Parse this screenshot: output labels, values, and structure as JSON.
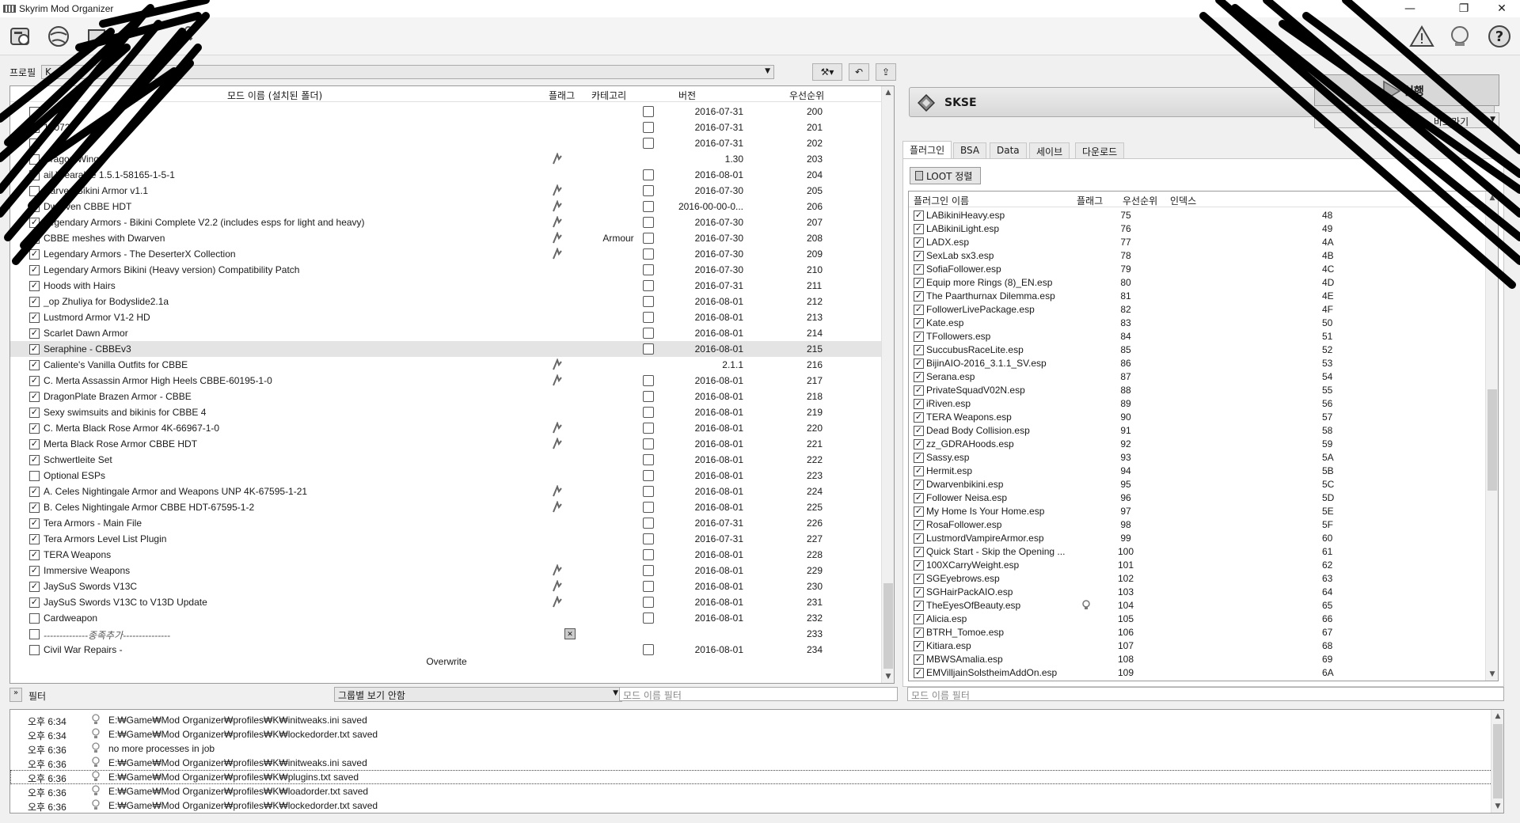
{
  "window": {
    "title": "Skyrim Mod Organizer",
    "minimize": "—",
    "maximize": "❐",
    "close": "✕"
  },
  "profile": {
    "label": "프로필",
    "value": "K"
  },
  "modlist": {
    "headers": {
      "name": "모드 이름 (설치된 폴더)",
      "flags": "플래그",
      "category": "카테고리",
      "version": "버전",
      "priority": "우선순위"
    },
    "rows": [
      {
        "name": "",
        "checked": "",
        "flag": false,
        "category": "",
        "verico": true,
        "version": "2016-07-31",
        "priority": "200"
      },
      {
        "name": "160721",
        "checked": "",
        "flag": false,
        "category": "",
        "verico": true,
        "version": "2016-07-31",
        "priority": "201"
      },
      {
        "name": "",
        "checked": "",
        "flag": false,
        "category": "",
        "verico": true,
        "version": "2016-07-31",
        "priority": "202"
      },
      {
        "name": "Dragon Wings",
        "checked": "",
        "flag": true,
        "category": "",
        "verico": false,
        "version": "1.30",
        "priority": "203"
      },
      {
        "name": "ail Wearable 1.5.1-58165-1-5-1",
        "checked": "",
        "flag": false,
        "category": "",
        "verico": true,
        "version": "2016-08-01",
        "priority": "204"
      },
      {
        "name": "warven Bikini Armor v1.1",
        "checked": "",
        "flag": true,
        "category": "",
        "verico": true,
        "version": "2016-07-30",
        "priority": "205"
      },
      {
        "name": "Dwarven CBBE HDT",
        "checked": "",
        "flag": true,
        "category": "",
        "verico": true,
        "version": "2016-00-00-0...",
        "priority": "206"
      },
      {
        "name": "Legendary Armors - Bikini Complete V2.2 (includes esps for light and heavy)",
        "checked": "✓",
        "flag": true,
        "category": "",
        "verico": true,
        "version": "2016-07-30",
        "priority": "207"
      },
      {
        "name": "CBBE meshes with Dwarven",
        "checked": "✓",
        "flag": true,
        "category": "Armour",
        "verico": true,
        "version": "2016-07-30",
        "priority": "208"
      },
      {
        "name": "Legendary Armors - The DeserterX Collection",
        "checked": "✓",
        "flag": true,
        "category": "",
        "verico": true,
        "version": "2016-07-30",
        "priority": "209"
      },
      {
        "name": "Legendary Armors Bikini (Heavy version) Compatibility Patch",
        "checked": "✓",
        "flag": false,
        "category": "",
        "verico": true,
        "version": "2016-07-30",
        "priority": "210"
      },
      {
        "name": "Hoods with Hairs",
        "checked": "✓",
        "flag": false,
        "category": "",
        "verico": true,
        "version": "2016-07-31",
        "priority": "211"
      },
      {
        "name": "_op Zhuliya for Bodyslide2.1a",
        "checked": "✓",
        "flag": false,
        "category": "",
        "verico": true,
        "version": "2016-08-01",
        "priority": "212"
      },
      {
        "name": "Lustmord Armor V1-2 HD",
        "checked": "✓",
        "flag": false,
        "category": "",
        "verico": true,
        "version": "2016-08-01",
        "priority": "213"
      },
      {
        "name": "Scarlet Dawn Armor",
        "checked": "✓",
        "flag": false,
        "category": "",
        "verico": true,
        "version": "2016-08-01",
        "priority": "214"
      },
      {
        "name": "Seraphine - CBBEv3",
        "checked": "✓",
        "flag": false,
        "category": "",
        "verico": true,
        "version": "2016-08-01",
        "priority": "215",
        "selected": true
      },
      {
        "name": "Caliente's Vanilla Outfits for CBBE",
        "checked": "✓",
        "flag": true,
        "category": "",
        "verico": false,
        "version": "2.1.1",
        "priority": "216"
      },
      {
        "name": "C. Merta Assassin Armor High Heels CBBE-60195-1-0",
        "checked": "✓",
        "flag": true,
        "category": "",
        "verico": true,
        "version": "2016-08-01",
        "priority": "217"
      },
      {
        "name": "DragonPlate Brazen Armor - CBBE",
        "checked": "✓",
        "flag": false,
        "category": "",
        "verico": true,
        "version": "2016-08-01",
        "priority": "218"
      },
      {
        "name": "Sexy swimsuits and bikinis for CBBE 4",
        "checked": "✓",
        "flag": false,
        "category": "",
        "verico": true,
        "version": "2016-08-01",
        "priority": "219"
      },
      {
        "name": "C. Merta Black Rose Armor 4K-66967-1-0",
        "checked": "✓",
        "flag": true,
        "category": "",
        "verico": true,
        "version": "2016-08-01",
        "priority": "220"
      },
      {
        "name": "Merta Black Rose Armor CBBE HDT",
        "checked": "✓",
        "flag": true,
        "category": "",
        "verico": true,
        "version": "2016-08-01",
        "priority": "221"
      },
      {
        "name": "Schwertleite Set",
        "checked": "✓",
        "flag": false,
        "category": "",
        "verico": true,
        "version": "2016-08-01",
        "priority": "222"
      },
      {
        "name": "Optional ESPs",
        "checked": "",
        "flag": false,
        "category": "",
        "verico": true,
        "version": "2016-08-01",
        "priority": "223"
      },
      {
        "name": "A. Celes Nightingale Armor and Weapons UNP 4K-67595-1-21",
        "checked": "✓",
        "flag": true,
        "category": "",
        "verico": true,
        "version": "2016-08-01",
        "priority": "224"
      },
      {
        "name": "B. Celes Nightingale Armor CBBE HDT-67595-1-2",
        "checked": "✓",
        "flag": true,
        "category": "",
        "verico": true,
        "version": "2016-08-01",
        "priority": "225"
      },
      {
        "name": "Tera Armors - Main File",
        "checked": "✓",
        "flag": false,
        "category": "",
        "verico": true,
        "version": "2016-07-31",
        "priority": "226"
      },
      {
        "name": "Tera Armors Level List Plugin",
        "checked": "✓",
        "flag": false,
        "category": "",
        "verico": true,
        "version": "2016-07-31",
        "priority": "227"
      },
      {
        "name": "TERA Weapons",
        "checked": "✓",
        "flag": false,
        "category": "",
        "verico": true,
        "version": "2016-08-01",
        "priority": "228"
      },
      {
        "name": "Immersive Weapons",
        "checked": "✓",
        "flag": true,
        "category": "",
        "verico": true,
        "version": "2016-08-01",
        "priority": "229"
      },
      {
        "name": "JaySuS Swords V13C",
        "checked": "✓",
        "flag": true,
        "category": "",
        "verico": true,
        "version": "2016-08-01",
        "priority": "230"
      },
      {
        "name": "JaySuS Swords V13C to V13D Update",
        "checked": "✓",
        "flag": true,
        "category": "",
        "verico": true,
        "version": "2016-08-01",
        "priority": "231"
      },
      {
        "name": "Cardweapon",
        "checked": "",
        "flag": false,
        "category": "",
        "verico": true,
        "version": "2016-08-01",
        "priority": "232"
      },
      {
        "name": "--------------종족추가---------------",
        "checked": "",
        "flag": false,
        "separator": true,
        "category": "",
        "verico": false,
        "version": "",
        "priority": "233"
      },
      {
        "name": "Civil War Repairs -",
        "checked": "",
        "flag": false,
        "category": "",
        "verico": true,
        "version": "2016-08-01",
        "priority": "234"
      }
    ],
    "overwrite": "Overwrite"
  },
  "filter": {
    "label": "필터",
    "group_value": "그룹별 보기 안함",
    "mod_filter_placeholder": "모드 이름 필터",
    "plugin_filter_placeholder": "모드 이름 필터"
  },
  "executable": {
    "name": "SKSE",
    "run_label": "실행",
    "shortcut_label": "바로가기"
  },
  "tabs": [
    "플러그인",
    "BSA",
    "Data",
    "세이브",
    "다운로드"
  ],
  "plugins": {
    "sort_button": "LOOT 정렬",
    "headers": {
      "name": "플러그인 이름",
      "flags": "플래그",
      "priority": "우선순위",
      "index": "인덱스"
    },
    "rows": [
      {
        "name": "LABikiniHeavy.esp",
        "priority": "75",
        "index": "48"
      },
      {
        "name": "LABikiniLight.esp",
        "priority": "76",
        "index": "49"
      },
      {
        "name": "LADX.esp",
        "priority": "77",
        "index": "4A"
      },
      {
        "name": "SexLab sx3.esp",
        "priority": "78",
        "index": "4B"
      },
      {
        "name": "SofiaFollower.esp",
        "priority": "79",
        "index": "4C"
      },
      {
        "name": "Equip more Rings (8)_EN.esp",
        "priority": "80",
        "index": "4D"
      },
      {
        "name": "The Paarthurnax Dilemma.esp",
        "priority": "81",
        "index": "4E"
      },
      {
        "name": "FollowerLivePackage.esp",
        "priority": "82",
        "index": "4F"
      },
      {
        "name": "Kate.esp",
        "priority": "83",
        "index": "50"
      },
      {
        "name": "TFollowers.esp",
        "priority": "84",
        "index": "51"
      },
      {
        "name": "SuccubusRaceLite.esp",
        "priority": "85",
        "index": "52"
      },
      {
        "name": "BijinAIO-2016_3.1.1_SV.esp",
        "priority": "86",
        "index": "53"
      },
      {
        "name": "Serana.esp",
        "priority": "87",
        "index": "54"
      },
      {
        "name": "PrivateSquadV02N.esp",
        "priority": "88",
        "index": "55"
      },
      {
        "name": "iRiven.esp",
        "priority": "89",
        "index": "56"
      },
      {
        "name": "TERA Weapons.esp",
        "priority": "90",
        "index": "57"
      },
      {
        "name": "Dead Body Collision.esp",
        "priority": "91",
        "index": "58"
      },
      {
        "name": "zz_GDRAHoods.esp",
        "priority": "92",
        "index": "59"
      },
      {
        "name": "Sassy.esp",
        "priority": "93",
        "index": "5A"
      },
      {
        "name": "Hermit.esp",
        "priority": "94",
        "index": "5B"
      },
      {
        "name": "Dwarvenbikini.esp",
        "priority": "95",
        "index": "5C"
      },
      {
        "name": "Follower Neisa.esp",
        "priority": "96",
        "index": "5D"
      },
      {
        "name": "My Home Is Your Home.esp",
        "priority": "97",
        "index": "5E"
      },
      {
        "name": "RosaFollower.esp",
        "priority": "98",
        "index": "5F"
      },
      {
        "name": "LustmordVampireArmor.esp",
        "priority": "99",
        "index": "60"
      },
      {
        "name": "Quick Start - Skip the Opening ...",
        "priority": "100",
        "index": "61"
      },
      {
        "name": "100XCarryWeight.esp",
        "priority": "101",
        "index": "62"
      },
      {
        "name": "SGEyebrows.esp",
        "priority": "102",
        "index": "63"
      },
      {
        "name": "SGHairPackAIO.esp",
        "priority": "103",
        "index": "64"
      },
      {
        "name": "TheEyesOfBeauty.esp",
        "priority": "104",
        "index": "65",
        "flag": true
      },
      {
        "name": "Alicia.esp",
        "priority": "105",
        "index": "66"
      },
      {
        "name": "BTRH_Tomoe.esp",
        "priority": "106",
        "index": "67"
      },
      {
        "name": "Kitiara.esp",
        "priority": "107",
        "index": "68"
      },
      {
        "name": "MBWSAmalia.esp",
        "priority": "108",
        "index": "69"
      },
      {
        "name": "EMVilljainSolstheimAddOn.esp",
        "priority": "109",
        "index": "6A"
      }
    ]
  },
  "log": [
    {
      "time": "오후 6:34",
      "msg": "E:₩Game₩Mod Organizer₩profiles₩K₩initweaks.ini saved"
    },
    {
      "time": "오후 6:34",
      "msg": "E:₩Game₩Mod Organizer₩profiles₩K₩lockedorder.txt saved"
    },
    {
      "time": "오후 6:36",
      "msg": "no more processes in job"
    },
    {
      "time": "오후 6:36",
      "msg": "E:₩Game₩Mod Organizer₩profiles₩K₩initweaks.ini saved"
    },
    {
      "time": "오후 6:36",
      "msg": "E:₩Game₩Mod Organizer₩profiles₩K₩plugins.txt saved",
      "selected": true
    },
    {
      "time": "오후 6:36",
      "msg": "E:₩Game₩Mod Organizer₩profiles₩K₩loadorder.txt saved"
    },
    {
      "time": "오후 6:36",
      "msg": "E:₩Game₩Mod Organizer₩profiles₩K₩lockedorder.txt saved"
    }
  ]
}
